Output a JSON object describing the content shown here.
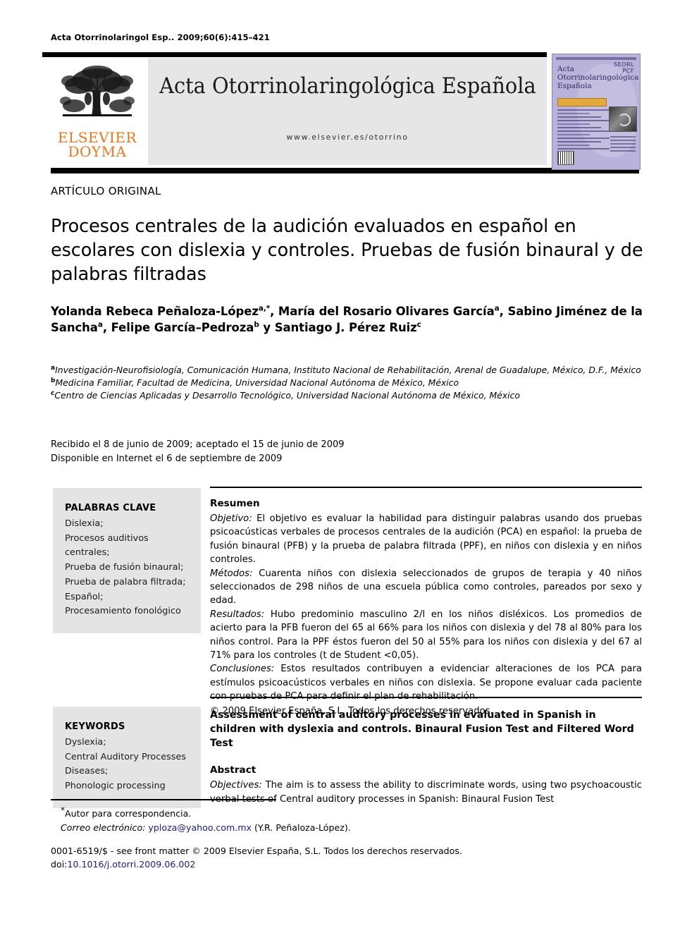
{
  "running_head": "Acta Otorrinolaringol Esp.. 2009;60(6):415–421",
  "masthead": {
    "publisher_line1": "ELSEVIER",
    "publisher_line2": "DOYMA",
    "journal_title": "Acta Otorrinolaringológica Española",
    "journal_url": "www.elsevier.es/otorrino",
    "logo_icon": "elsevier-tree-logo"
  },
  "cover": {
    "title_line1": "Acta",
    "title_line2": "Otorrinolaringológica",
    "title_line3": "Española",
    "seal_text": "SEORL PCF"
  },
  "article": {
    "kicker": "ARTÍCULO ORIGINAL",
    "title": "Procesos centrales de la audición evaluados en español en escolares con dislexia y controles. Pruebas de fusión binaural y de palabras filtradas",
    "authors_html": "Yolanda Rebeca Peñaloza-López<sup>a,*</sup>, María del Rosario Olivares García<sup>a</sup>, Sabino Jiménez de la Sancha<sup>a</sup>, Felipe García–Pedroza<sup>b</sup> y Santiago J. Pérez Ruiz<sup>c</sup>",
    "affiliations": [
      "Investigación-Neurofisiología, Comunicación Humana, Instituto Nacional de Rehabilitación, Arenal de Guadalupe, México, D.F., México",
      "Medicina Familiar, Facultad de Medicina, Universidad Nacional Autónoma de México, México",
      "Centro de Ciencias Aplicadas y Desarrollo Tecnológico, Universidad Nacional Autónoma de México, México"
    ],
    "affiliation_marks": [
      "a",
      "b",
      "c"
    ],
    "date_received": "Recibido el 8 de junio de 2009; aceptado el 15 de junio de 2009",
    "date_online": "Disponible en Internet el 6 de septiembre de 2009"
  },
  "keywords_es": {
    "heading": "PALABRAS CLAVE",
    "items": [
      "Dislexia;",
      "Procesos auditivos centrales;",
      "Prueba de fusión binaural;",
      "Prueba de palabra filtrada;",
      "Español;",
      "Procesamiento fonológico"
    ]
  },
  "keywords_en": {
    "heading": "KEYWORDS",
    "items": [
      "Dyslexia;",
      "Central Auditory Processes Diseases;",
      "Phonologic processing"
    ]
  },
  "abstract_es": {
    "heading": "Resumen",
    "objetivo_label": "Objetivo:",
    "objetivo_text": " El objetivo es evaluar la habilidad para distinguir palabras usando dos pruebas psicoacústicas verbales de procesos centrales de la audición (PCA) en español: la prueba de fusión binaural (PFB) y la prueba de palabra filtrada (PPF), en niños con dislexia y en niños controles.",
    "metodos_label": "Métodos:",
    "metodos_text": " Cuarenta niños con dislexia seleccionados de grupos de terapia y 40 niños seleccionados de 298 niños de una escuela pública como controles, pareados por sexo y edad.",
    "resultados_label": "Resultados:",
    "resultados_text": " Hubo predominio masculino 2/l en los niños disléxicos. Los promedios de acierto para la PFB fueron del 65 al 66% para los niños con dislexia y del 78 al 80% para los niños control. Para la PPF éstos fueron del 50 al 55% para los niños con dislexia y del 67 al 71% para los controles (t de Student <0,05).",
    "conclusiones_label": "Conclusiones:",
    "conclusiones_text": " Estos resultados contribuyen a evidenciar alteraciones de los PCA para estímulos psicoacústicos verbales en niños con dislexia. Se propone evaluar cada paciente con pruebas de PCA para definir el plan de rehabilitación.",
    "copyright": "© 2009 Elsevier España, S.L. Todos los derechos reservados."
  },
  "abstract_en": {
    "title": "Assessment of central auditory processes in evaluated in Spanish in children with dyslexia and controls. Binaural Fusion Test and Filtered Word Test",
    "heading": "Abstract",
    "objectives_label": "Objectives:",
    "objectives_text": " The aim is to assess the ability to discriminate words, using two psychoacoustic verbal tests of Central auditory processes in Spanish: Binaural Fusion Test"
  },
  "footer": {
    "corresponding_note": "Autor para correspondencia.",
    "email_label": "Correo electrónico:",
    "email": "yploza@yahoo.com.mx",
    "email_owner": "(Y.R. Peñaloza-López).",
    "issn_line": "0001-6519/$ - see front matter © 2009 Elsevier España, S.L. Todos los derechos reservados.",
    "doi_prefix": "doi:",
    "doi_value": "10.1016/j.otorri.2009.06.002"
  },
  "colors": {
    "elsevier_orange": "#E87722",
    "banner_gray": "#e6e6e6",
    "keyword_box_gray": "#e4e4e4",
    "link_navy": "#1a1a7e",
    "cover_lavender": "#b9b2da"
  }
}
